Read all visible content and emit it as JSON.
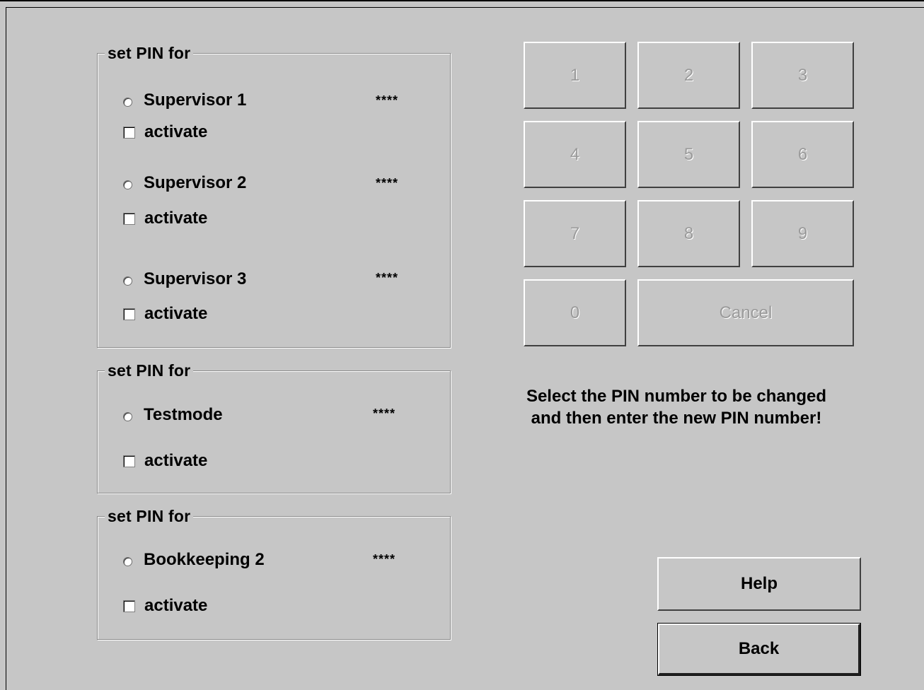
{
  "groups": [
    {
      "legend": "set PIN for",
      "entries": [
        {
          "name": "Supervisor 1",
          "pin": "****",
          "activate_label": "activate"
        },
        {
          "name": "Supervisor 2",
          "pin": "****",
          "activate_label": "activate"
        },
        {
          "name": "Supervisor 3",
          "pin": "****",
          "activate_label": "activate"
        }
      ]
    },
    {
      "legend": "set PIN for",
      "entries": [
        {
          "name": "Testmode",
          "pin": "****",
          "activate_label": "activate"
        }
      ]
    },
    {
      "legend": "set PIN for",
      "entries": [
        {
          "name": "Bookkeeping 2",
          "pin": "****",
          "activate_label": "activate"
        }
      ]
    }
  ],
  "keypad": {
    "keys": [
      "1",
      "2",
      "3",
      "4",
      "5",
      "6",
      "7",
      "8",
      "9",
      "0"
    ],
    "cancel_label": "Cancel"
  },
  "instructions": {
    "line1": "Select the PIN number to be changed",
    "line2": "and then enter the new PIN number!"
  },
  "actions": {
    "help_label": "Help",
    "back_label": "Back"
  }
}
